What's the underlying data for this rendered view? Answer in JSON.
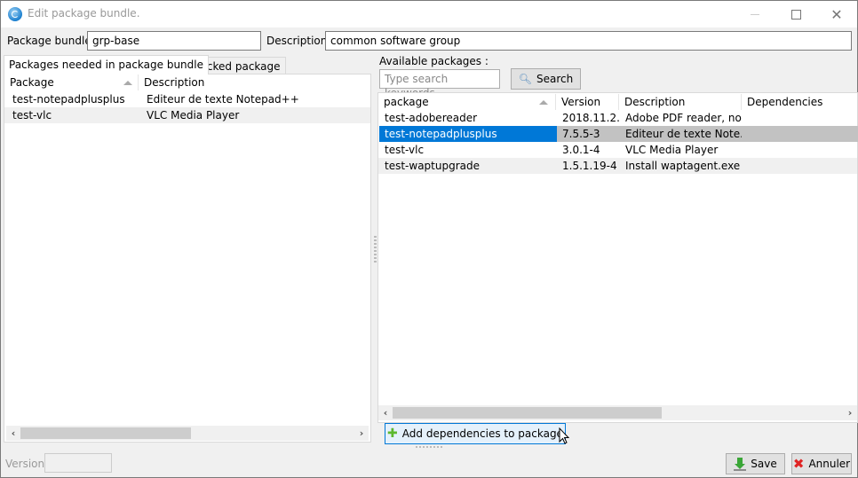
{
  "window": {
    "title": "Edit package bundle."
  },
  "form": {
    "bundle_label": "Package bundle",
    "bundle_value": "grp-base",
    "description_label": "Description",
    "description_value": "common software group",
    "version_label": "Version",
    "version_value": ""
  },
  "tabs": [
    {
      "label": "Packages needed in package bundle",
      "active": true
    },
    {
      "label": "Blocked package",
      "active": false
    }
  ],
  "bundle_grid": {
    "columns": [
      "Package",
      "Description"
    ],
    "sort_column": "Package",
    "rows": [
      {
        "package": "test-notepadplusplus",
        "description": "Editeur de texte Notepad++"
      },
      {
        "package": "test-vlc",
        "description": "VLC Media Player"
      }
    ]
  },
  "available": {
    "label": "Available packages :",
    "search_placeholder": "Type search keywords",
    "search_value": "",
    "search_button": "Search",
    "columns": [
      "package",
      "Version",
      "Description",
      "Dependencies"
    ],
    "sort_column": "package",
    "selected_row": 1,
    "rows": [
      {
        "package": "test-adobereader",
        "version": "2018.11.2...",
        "description": "Adobe PDF reader, no...",
        "dependencies": ""
      },
      {
        "package": "test-notepadplusplus",
        "version": "7.5.5-3",
        "description": "Editeur de texte Note...",
        "dependencies": ""
      },
      {
        "package": "test-vlc",
        "version": "3.0.1-4",
        "description": "VLC Media Player",
        "dependencies": ""
      },
      {
        "package": "test-waptupgrade",
        "version": "1.5.1.19-4",
        "description": "Install waptagent.exe",
        "dependencies": ""
      }
    ]
  },
  "buttons": {
    "add_dependencies": "Add dependencies to package",
    "save": "Save",
    "cancel": "Annuler"
  },
  "colors": {
    "selection": "#0078d7",
    "selection_secondary": "#c2c2c2",
    "add_icon": "#5cb82e",
    "save_icon": "#3aa637",
    "cancel_icon": "#e02424"
  }
}
